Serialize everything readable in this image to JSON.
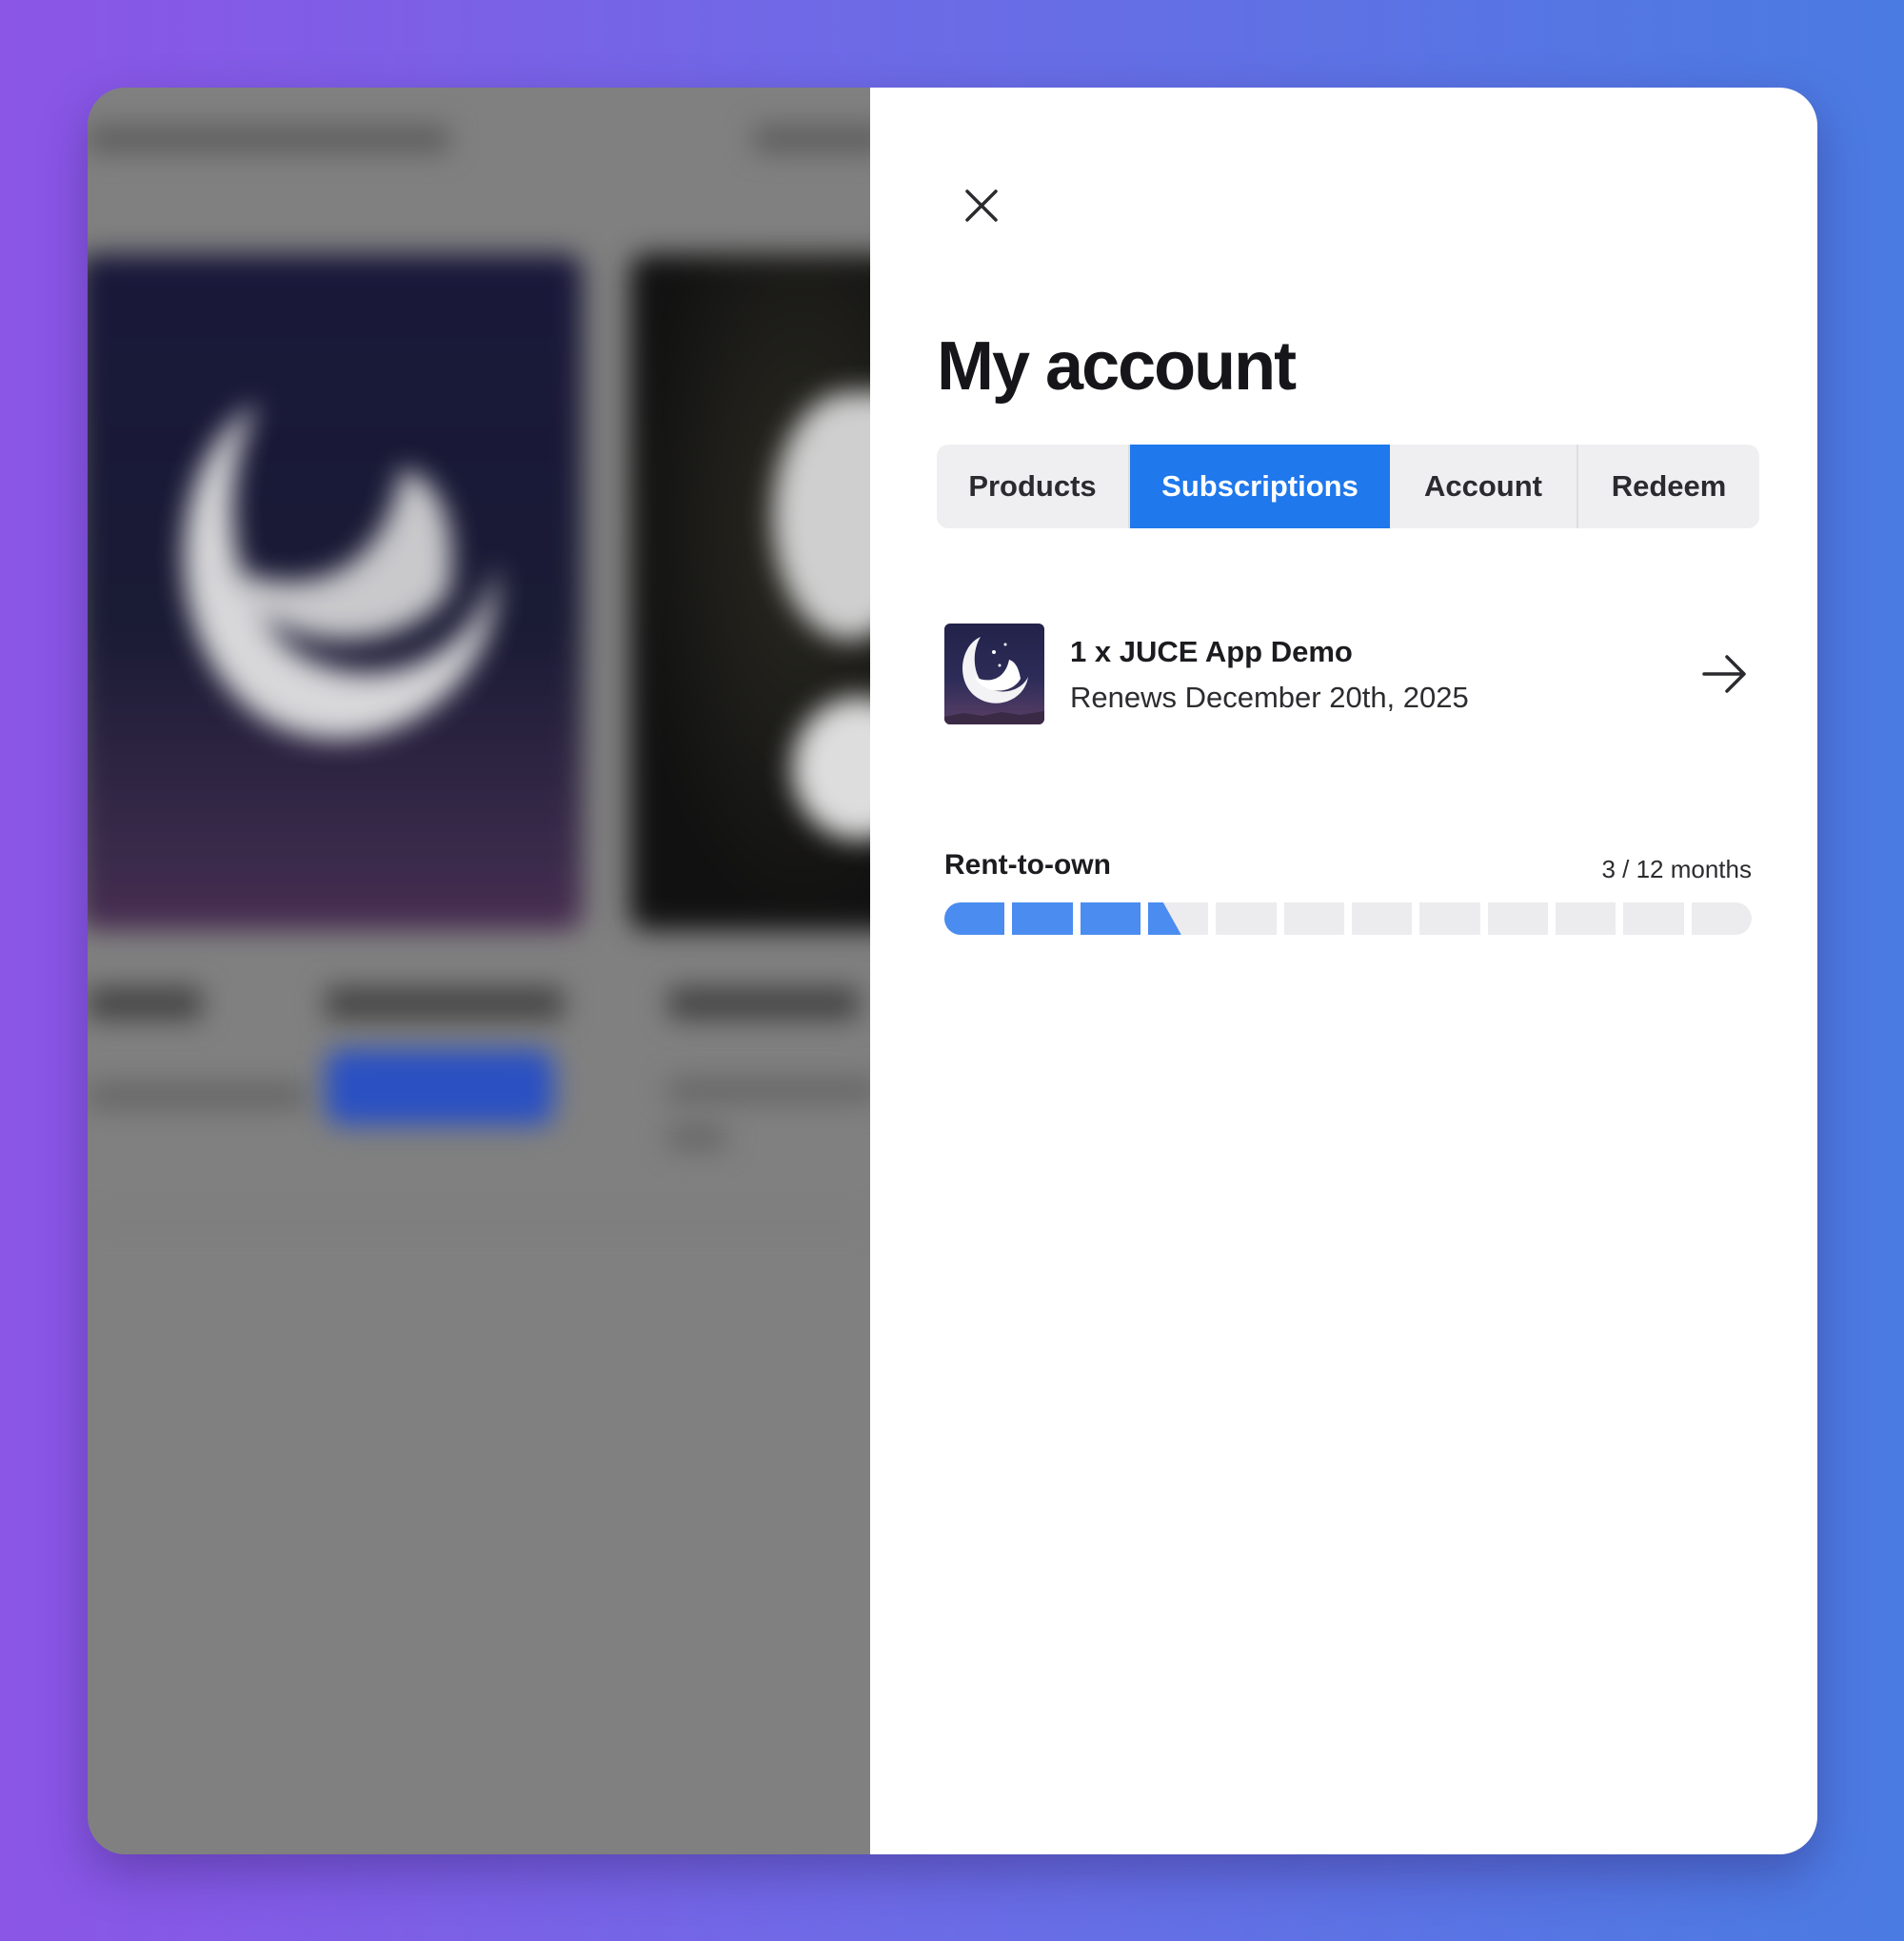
{
  "panel": {
    "title": "My account",
    "close_icon": "close-icon"
  },
  "tabs": [
    {
      "label": "Products",
      "active": false
    },
    {
      "label": "Subscriptions",
      "active": true
    },
    {
      "label": "Account",
      "active": false
    },
    {
      "label": "Redeem",
      "active": false
    }
  ],
  "subscription": {
    "name": "1 x JUCE App Demo",
    "renewal": "Renews December 20th, 2025",
    "thumbnail_icon": "moon-app-icon",
    "open_icon": "arrow-right-icon",
    "rent_to_own": {
      "label": "Rent-to-own",
      "progress_text": "3 / 12 months",
      "months_paid": 3,
      "months_total": 12,
      "partial_fraction": 0.4
    }
  },
  "colors": {
    "accent": "#1f78ec",
    "progress_fill": "#4a8cf0",
    "progress_empty": "#ececee",
    "overlay": "#808080"
  }
}
